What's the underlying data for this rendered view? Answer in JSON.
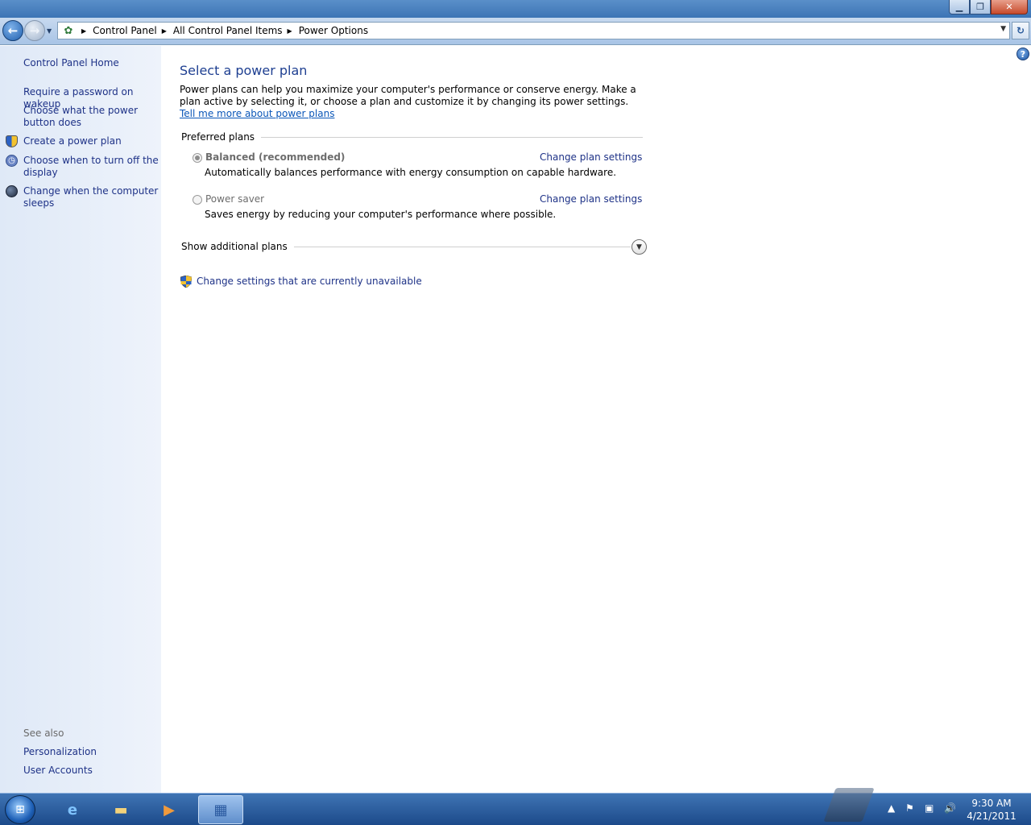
{
  "window": {
    "minimize_glyph": "▁",
    "maximize_glyph": "❐",
    "close_glyph": "✕"
  },
  "address_bar": {
    "crumbs": [
      "Control Panel",
      "All Control Panel Items",
      "Power Options"
    ]
  },
  "left_pane": {
    "home_link": "Control Panel Home",
    "tasks": [
      {
        "label": "Require a password on wakeup",
        "icon": "none"
      },
      {
        "label": "Choose what the power button does",
        "icon": "none"
      },
      {
        "label": "Create a power plan",
        "icon": "shield-icon"
      },
      {
        "label": "Choose when to turn off the display",
        "icon": "display-clock-icon"
      },
      {
        "label": "Change when the computer sleeps",
        "icon": "moon-icon"
      }
    ],
    "see_also_heading": "See also",
    "see_also_links": [
      "Personalization",
      "User Accounts"
    ]
  },
  "main": {
    "title": "Select a power plan",
    "intro_text": "Power plans can help you maximize your computer's performance or conserve energy. Make a plan active by selecting it, or choose a plan and customize it by changing its power settings. ",
    "intro_link": "Tell me more about power plans",
    "preferred_plans_label": "Preferred plans",
    "plans": [
      {
        "name": "Balanced (recommended)",
        "description": "Automatically balances performance with energy consumption on capable hardware.",
        "selected": true,
        "link": "Change plan settings"
      },
      {
        "name": "Power saver",
        "description": "Saves energy by reducing your computer's performance where possible.",
        "selected": false,
        "link": "Change plan settings"
      }
    ],
    "additional_plans_label": "Show additional plans",
    "unavailable_link": "Change settings that are currently unavailable"
  },
  "taskbar": {
    "time": "9:30 AM",
    "date": "4/21/2011",
    "apps": [
      "start-orb",
      "internet-explorer-icon",
      "windows-explorer-icon",
      "media-player-icon",
      "control-panel-icon"
    ]
  }
}
